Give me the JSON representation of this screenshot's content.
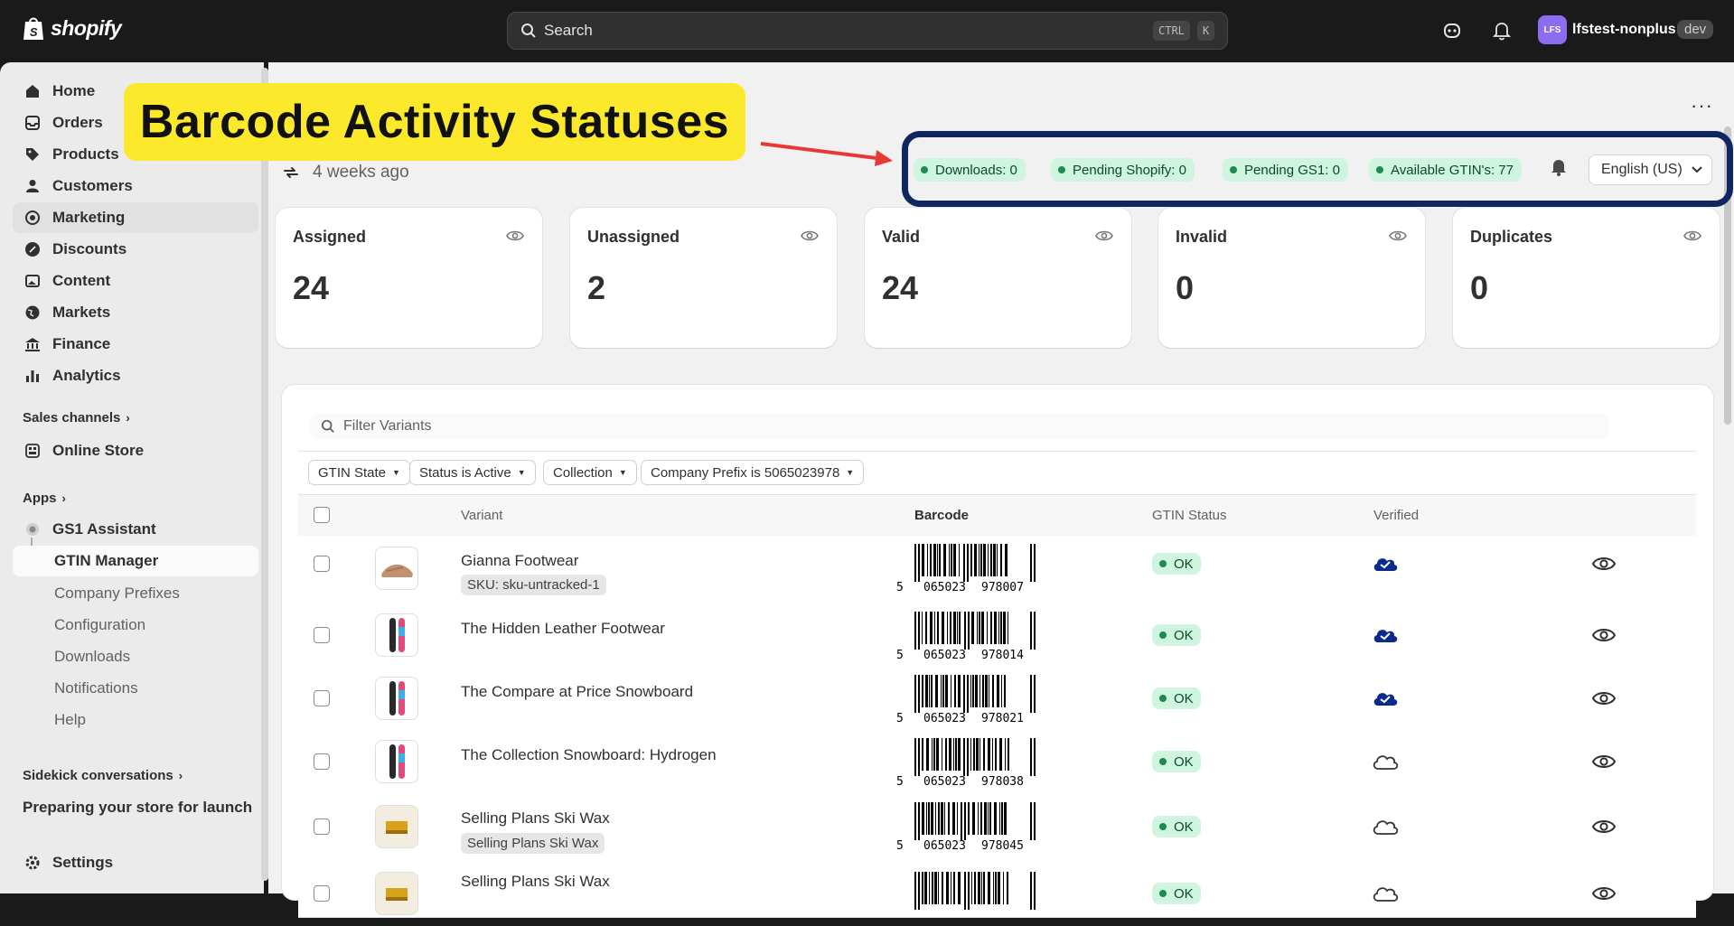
{
  "topbar": {
    "brand": "shopify",
    "search_placeholder": "Search",
    "shortcut_ctrl": "CTRL",
    "shortcut_key": "K",
    "avatar_initials": "LFS",
    "store_name": "lfstest-nonplus",
    "env_badge": "dev"
  },
  "sidebar": {
    "items": [
      {
        "label": "Home",
        "icon": "home-icon"
      },
      {
        "label": "Orders",
        "icon": "orders-icon"
      },
      {
        "label": "Products",
        "icon": "tag-icon"
      },
      {
        "label": "Customers",
        "icon": "person-icon"
      },
      {
        "label": "Marketing",
        "icon": "target-icon"
      },
      {
        "label": "Discounts",
        "icon": "discount-icon"
      },
      {
        "label": "Content",
        "icon": "image-icon"
      },
      {
        "label": "Markets",
        "icon": "globe-icon"
      },
      {
        "label": "Finance",
        "icon": "bank-icon"
      },
      {
        "label": "Analytics",
        "icon": "bar-chart-icon"
      }
    ],
    "sales_channels_title": "Sales channels",
    "online_store": "Online Store",
    "apps_title": "Apps",
    "gs1_assistant": "GS1 Assistant",
    "gtin_manager": "GTIN Manager",
    "subitems": [
      "Company Prefixes",
      "Configuration",
      "Downloads",
      "Notifications",
      "Help"
    ],
    "sidekick_title": "Sidekick conversations",
    "sidekick_item": "Preparing your store for launch",
    "settings": "Settings"
  },
  "annotation": {
    "title": "Barcode Activity Statuses"
  },
  "statusbar": {
    "downloads": "Downloads: 0",
    "pending_shopify": "Pending Shopify: 0",
    "pending_gs1": "Pending GS1: 0",
    "available_gtins": "Available GTIN's: 77",
    "language": "English (US)"
  },
  "sync": {
    "last_synced": "4 weeks ago"
  },
  "cards": [
    {
      "title": "Assigned",
      "value": "24"
    },
    {
      "title": "Unassigned",
      "value": "2"
    },
    {
      "title": "Valid",
      "value": "24"
    },
    {
      "title": "Invalid",
      "value": "0"
    },
    {
      "title": "Duplicates",
      "value": "0"
    }
  ],
  "filters": {
    "placeholder": "Filter Variants",
    "chips": [
      "GTIN State",
      "Status is Active",
      "Collection",
      "Company Prefix is 5065023978"
    ]
  },
  "table": {
    "headers": {
      "variant": "Variant",
      "barcode": "Barcode",
      "gtin_status": "GTIN Status",
      "verified": "Verified"
    },
    "rows": [
      {
        "name": "Gianna Footwear",
        "sku": "SKU: sku-untracked-1",
        "barcode_lead": "5",
        "barcode_left": "065023",
        "barcode_right": "978007",
        "status": "OK",
        "verified": true,
        "thumb": "shoe"
      },
      {
        "name": "The Hidden Leather Footwear",
        "sku": "",
        "barcode_lead": "5",
        "barcode_left": "065023",
        "barcode_right": "978014",
        "status": "OK",
        "verified": true,
        "thumb": "snowboard"
      },
      {
        "name": "The Compare at Price Snowboard",
        "sku": "",
        "barcode_lead": "5",
        "barcode_left": "065023",
        "barcode_right": "978021",
        "status": "OK",
        "verified": true,
        "thumb": "snowboard"
      },
      {
        "name": "The Collection Snowboard: Hydrogen",
        "sku": "",
        "barcode_lead": "5",
        "barcode_left": "065023",
        "barcode_right": "978038",
        "status": "OK",
        "verified": false,
        "thumb": "snowboard"
      },
      {
        "name": "Selling Plans Ski Wax",
        "sku": "Selling Plans Ski Wax",
        "barcode_lead": "5",
        "barcode_left": "065023",
        "barcode_right": "978045",
        "status": "OK",
        "verified": false,
        "thumb": "wax"
      },
      {
        "name": "Selling Plans Ski Wax",
        "sku": "",
        "barcode_lead": "",
        "barcode_left": "",
        "barcode_right": "",
        "status": "OK",
        "verified": false,
        "thumb": "wax"
      }
    ]
  },
  "colors": {
    "accent_yellow": "#fde92c",
    "callout_navy": "#0f2660",
    "status_green_bg": "#cff5e0",
    "verified_navy": "#0a2a8c"
  }
}
